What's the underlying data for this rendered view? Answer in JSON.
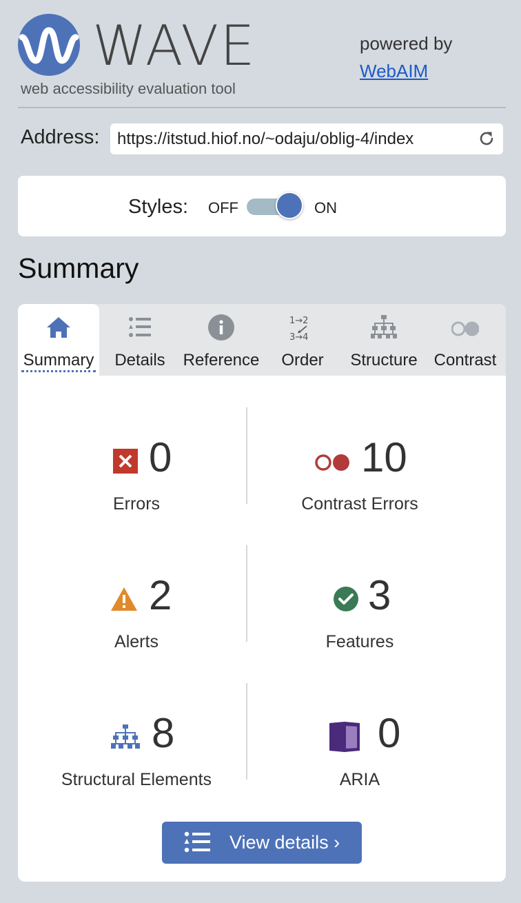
{
  "header": {
    "app_name": "WAVE",
    "tagline": "web accessibility evaluation tool",
    "powered_by": "powered by",
    "powered_link": "WebAIM"
  },
  "address": {
    "label": "Address:",
    "value": "https://itstud.hiof.no/~odaju/oblig-4/index",
    "reload_icon": "reload-icon"
  },
  "styles": {
    "label": "Styles:",
    "off": "OFF",
    "on": "ON",
    "state": "on"
  },
  "summary_heading": "Summary",
  "tabs": [
    {
      "label": "Summary",
      "icon": "home-icon",
      "active": true
    },
    {
      "label": "Details",
      "icon": "list-icon",
      "active": false
    },
    {
      "label": "Reference",
      "icon": "info-icon",
      "active": false
    },
    {
      "label": "Order",
      "icon": "order-icon",
      "active": false
    },
    {
      "label": "Structure",
      "icon": "structure-icon",
      "active": false
    },
    {
      "label": "Contrast",
      "icon": "contrast-icon",
      "active": false
    }
  ],
  "stats": {
    "errors": {
      "count": "0",
      "label": "Errors",
      "color": "#c0392b"
    },
    "contrast_errors": {
      "count": "10",
      "label": "Contrast Errors",
      "color": "#b23a3a"
    },
    "alerts": {
      "count": "2",
      "label": "Alerts",
      "color": "#e08a2c"
    },
    "features": {
      "count": "3",
      "label": "Features",
      "color": "#3a7a55"
    },
    "structural": {
      "count": "8",
      "label": "Structural Elements",
      "color": "#4e72b8"
    },
    "aria": {
      "count": "0",
      "label": "ARIA",
      "color": "#4a2a7a"
    }
  },
  "view_details": "View details ›",
  "colors": {
    "accent": "#4e72b8",
    "background": "#d4dadf",
    "link": "#1e59c8"
  }
}
